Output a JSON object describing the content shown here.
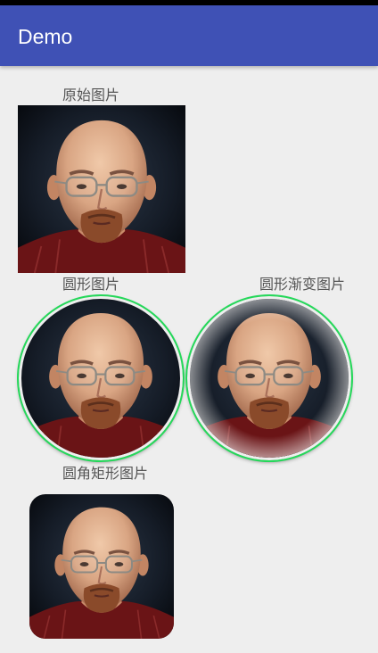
{
  "app": {
    "title": "Demo"
  },
  "labels": {
    "original": "原始图片",
    "circle": "圆形图片",
    "gradient_circle": "圆形渐变图片",
    "rounded_rect": "圆角矩形图片"
  },
  "colors": {
    "app_bar": "#3f51b5",
    "border_green": "#25d85a",
    "background": "#eeeeee"
  }
}
